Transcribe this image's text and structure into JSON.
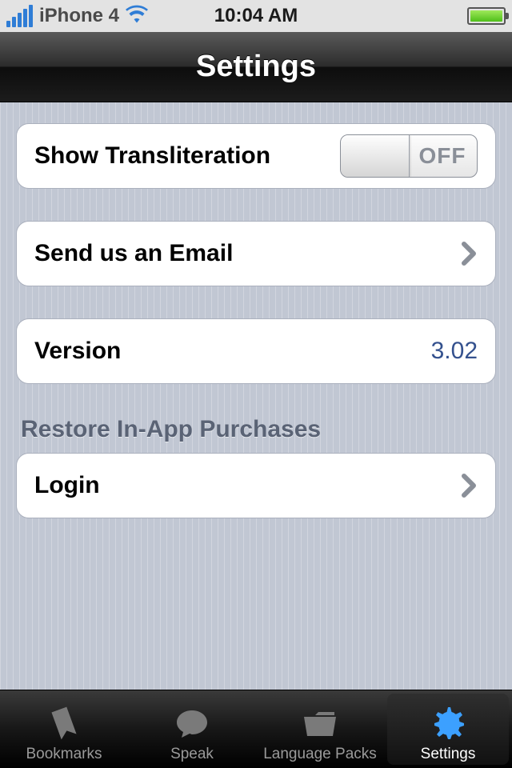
{
  "status_bar": {
    "carrier": "iPhone 4",
    "time": "10:04 AM"
  },
  "header": {
    "title": "Settings"
  },
  "rows": {
    "transliteration": {
      "label": "Show Transliteration",
      "toggle_value": "OFF"
    },
    "email": {
      "label": "Send us an Email"
    },
    "version": {
      "label": "Version",
      "value": "3.02"
    },
    "restore_header": "Restore In-App Purchases",
    "login": {
      "label": "Login"
    }
  },
  "tabs": {
    "bookmarks": "Bookmarks",
    "speak": "Speak",
    "language_packs": "Language Packs",
    "settings": "Settings"
  }
}
